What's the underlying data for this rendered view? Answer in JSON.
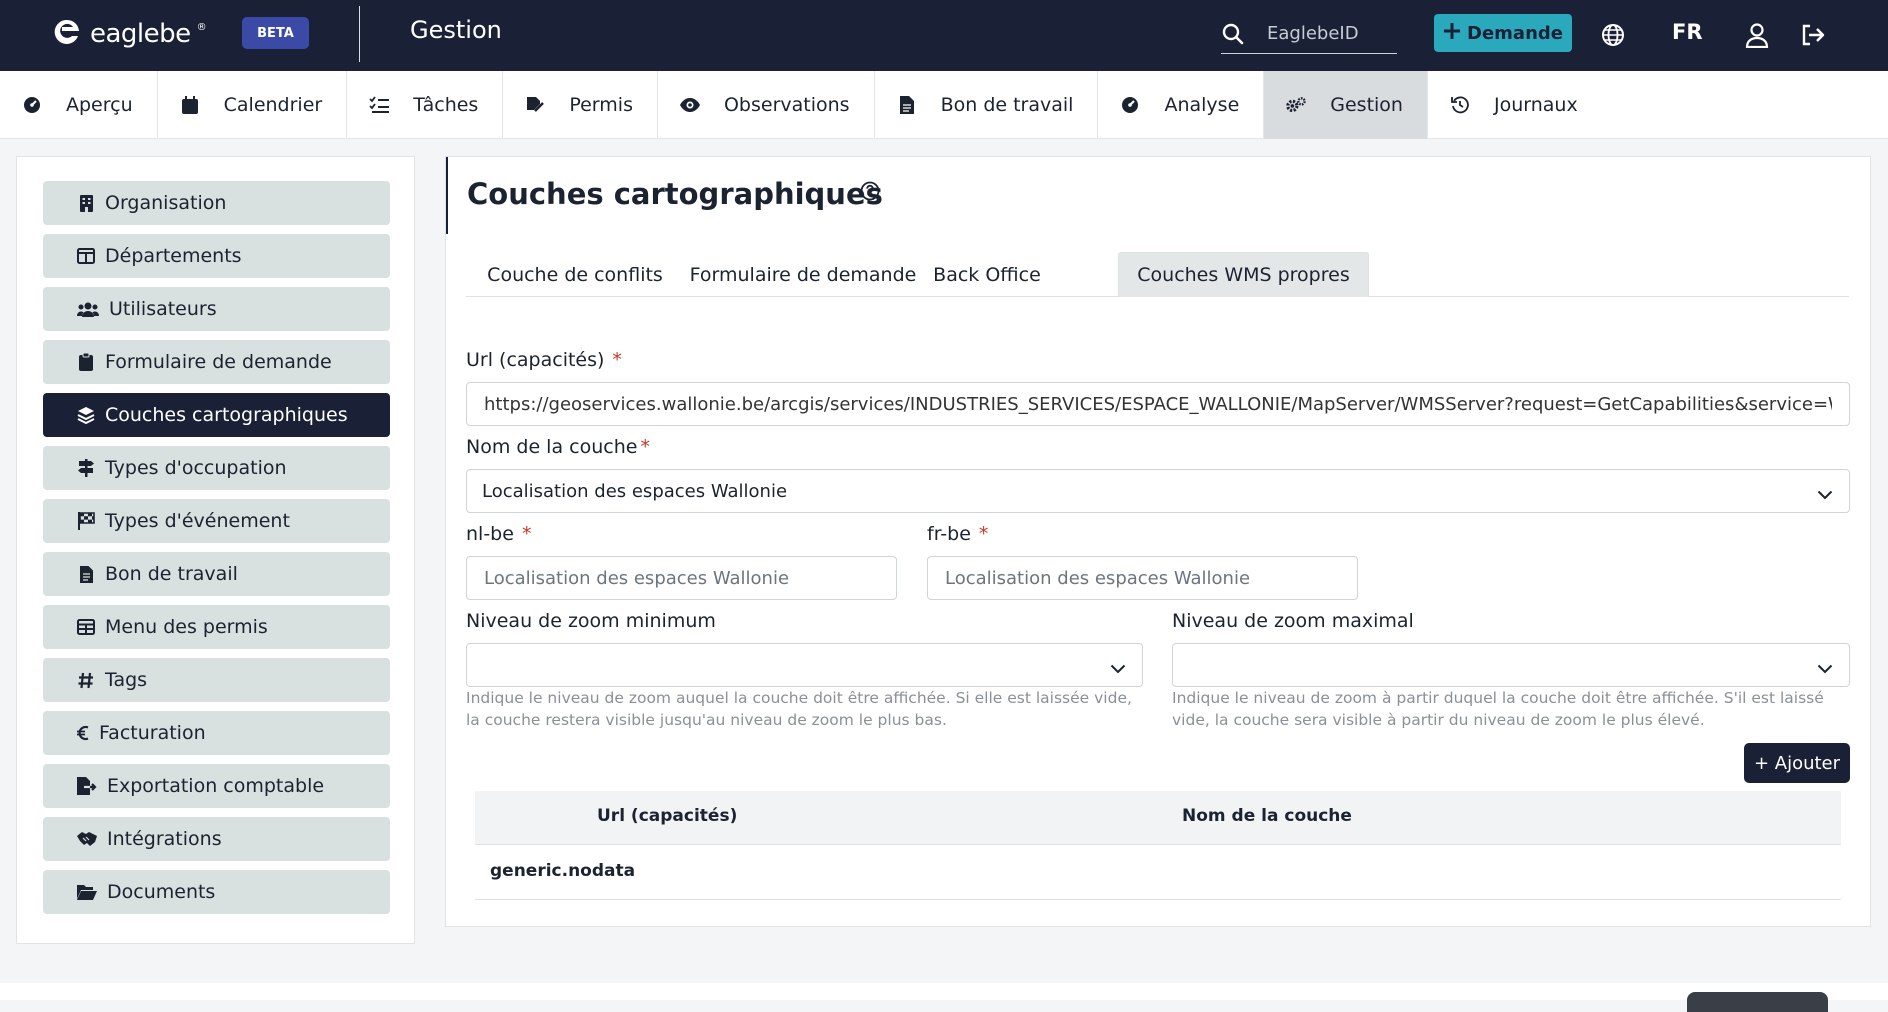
{
  "brand": {
    "name": "eaglebe",
    "beta": "BETA"
  },
  "header": {
    "title": "Gestion",
    "search_placeholder": "EaglebeID",
    "demande_label": "Demande",
    "language": "FR"
  },
  "modules": [
    {
      "label": "Aperçu",
      "icon": "gauge-icon"
    },
    {
      "label": "Calendrier",
      "icon": "calendar-icon"
    },
    {
      "label": "Tâches",
      "icon": "checklist-icon"
    },
    {
      "label": "Permis",
      "icon": "signature-icon"
    },
    {
      "label": "Observations",
      "icon": "eye-icon"
    },
    {
      "label": "Bon de travail",
      "icon": "file-icon"
    },
    {
      "label": "Analyse",
      "icon": "gauge-icon"
    },
    {
      "label": "Gestion",
      "icon": "gears-icon",
      "active": true
    },
    {
      "label": "Journaux",
      "icon": "history-icon"
    }
  ],
  "sidebar": {
    "items": [
      {
        "label": "Organisation",
        "icon": "building-icon"
      },
      {
        "label": "Départements",
        "icon": "table-columns-icon"
      },
      {
        "label": "Utilisateurs",
        "icon": "users-icon"
      },
      {
        "label": "Formulaire de demande",
        "icon": "clipboard-icon"
      },
      {
        "label": "Couches cartographiques",
        "icon": "layers-icon",
        "active": true
      },
      {
        "label": "Types d'occupation",
        "icon": "signs-icon"
      },
      {
        "label": "Types d'événement",
        "icon": "flag-checkered-icon"
      },
      {
        "label": "Bon de travail",
        "icon": "file-icon"
      },
      {
        "label": "Menu des permis",
        "icon": "table-icon"
      },
      {
        "label": "Tags",
        "icon": "hashtag-icon"
      },
      {
        "label": "Facturation",
        "icon": "euro-icon"
      },
      {
        "label": "Exportation comptable",
        "icon": "file-export-icon"
      },
      {
        "label": "Intégrations",
        "icon": "handshake-icon"
      },
      {
        "label": "Documents",
        "icon": "folder-open-icon"
      }
    ]
  },
  "main": {
    "title": "Couches cartographiques",
    "tabs": [
      {
        "label": "Couche de conflits"
      },
      {
        "label": "Formulaire de demande"
      },
      {
        "label": "Back Office"
      },
      {
        "label": "Couches WMS propres",
        "active": true
      }
    ],
    "form": {
      "url_label": "Url (capacités)",
      "url_value": "https://geoservices.wallonie.be/arcgis/services/INDUSTRIES_SERVICES/ESPACE_WALLONIE/MapServer/WMSServer?request=GetCapabilities&service=WMS",
      "layer_label": "Nom de la couche",
      "layer_value": "Localisation des espaces Wallonie",
      "nl_label": "nl-be",
      "nl_placeholder": "Localisation des espaces Wallonie",
      "fr_label": "fr-be",
      "fr_placeholder": "Localisation des espaces Wallonie",
      "zoom_min_label": "Niveau de zoom minimum",
      "zoom_min_hint": "Indique le niveau de zoom auquel la couche doit être affichée. Si elle est laissée vide, la couche restera visible jusqu'au niveau de zoom le plus bas.",
      "zoom_max_label": "Niveau de zoom maximal",
      "zoom_max_hint": "Indique le niveau de zoom à partir duquel la couche doit être affichée. S'il est laissé vide, la couche sera visible à partir du niveau de zoom le plus élevé.",
      "required_mark": "*"
    },
    "add_button": "+ Ajouter",
    "table": {
      "columns": [
        "Url (capacités)",
        "Nom de la couche"
      ],
      "empty_text": "generic.nodata"
    }
  },
  "colors": {
    "navy": "#1a2035",
    "teal": "#2aa9bd",
    "sidebar_item": "#d8e0e0",
    "required": "#c0392b"
  }
}
